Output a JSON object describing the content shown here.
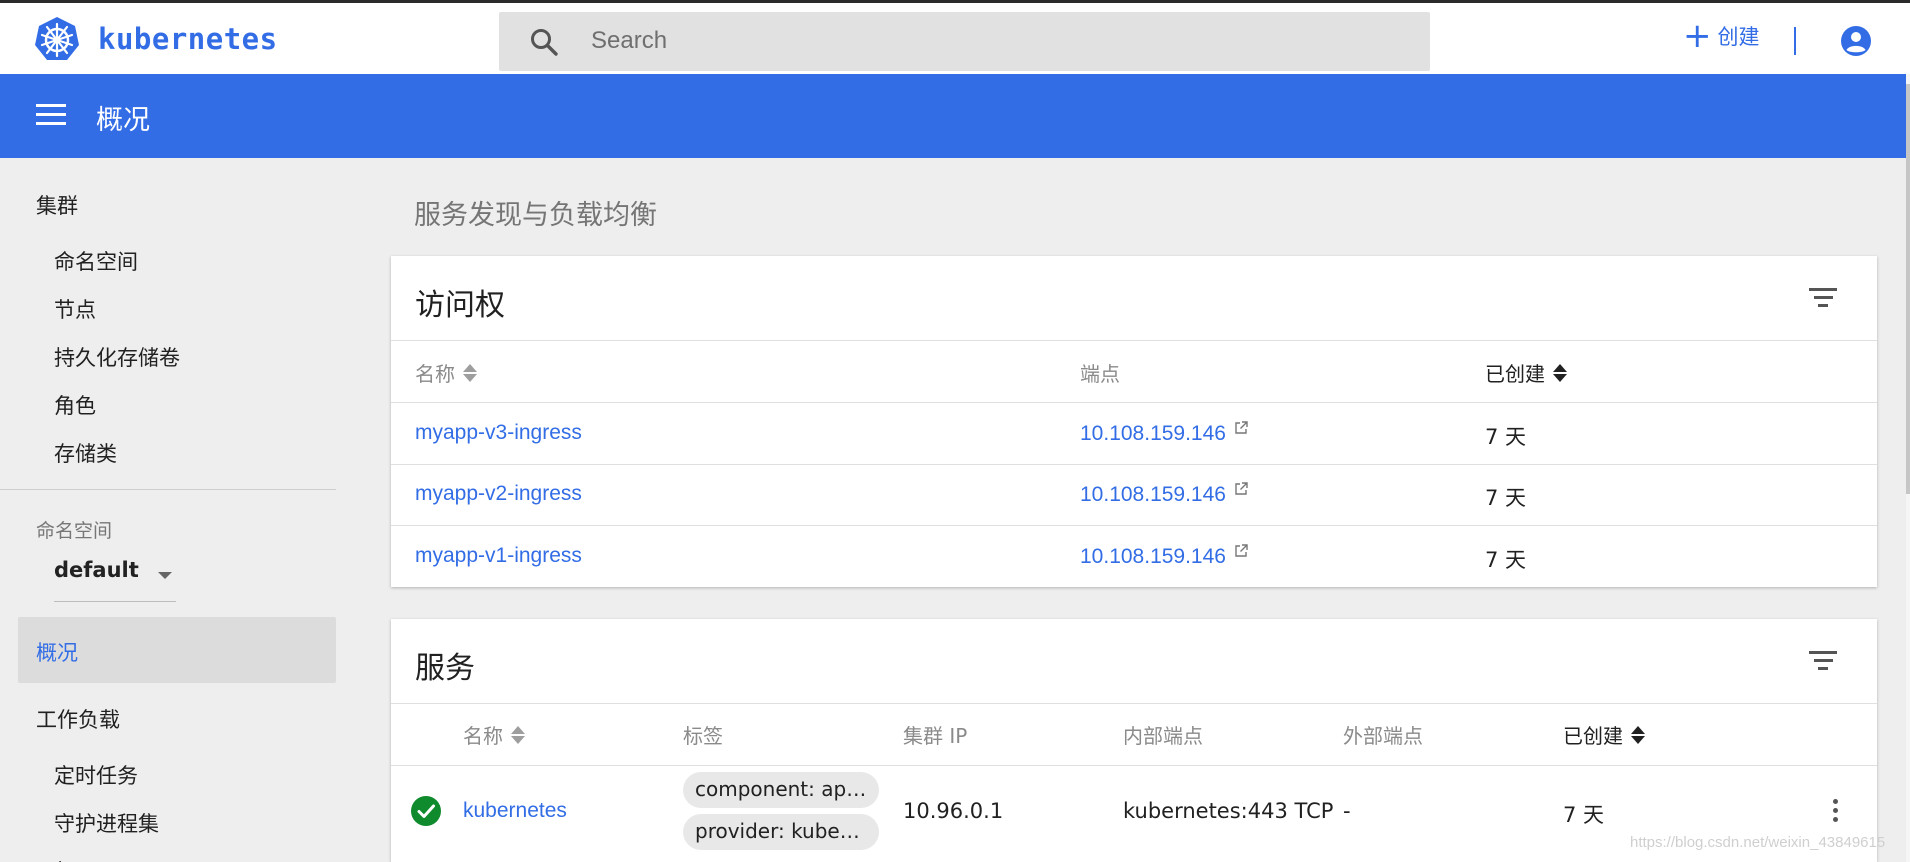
{
  "topbar": {
    "brand": "kubernetes",
    "search_placeholder": "Search",
    "create_label": "创建",
    "icons": {
      "logo": "kubernetes-wheel-icon",
      "search": "search-icon",
      "create": "plus-icon",
      "account": "account-circle-icon"
    }
  },
  "header": {
    "title": "概况",
    "menu_icon": "hamburger-menu-icon"
  },
  "sidebar": {
    "cluster_label": "集群",
    "cluster_items": [
      "命名空间",
      "节点",
      "持久化存储卷",
      "角色",
      "存储类"
    ],
    "namespace_label": "命名空间",
    "namespace_value": "default",
    "active_item": "概况",
    "workload_label": "工作负载",
    "workload_items": [
      "定时任务",
      "守护进程集",
      "部署"
    ]
  },
  "main": {
    "section_title": "服务发现与负载均衡",
    "ingress": {
      "title": "访问权",
      "columns": [
        "名称",
        "端点",
        "已创建"
      ],
      "rows": [
        {
          "name": "myapp-v3-ingress",
          "endpoint": "10.108.159.146",
          "created": "7 天"
        },
        {
          "name": "myapp-v2-ingress",
          "endpoint": "10.108.159.146",
          "created": "7 天"
        },
        {
          "name": "myapp-v1-ingress",
          "endpoint": "10.108.159.146",
          "created": "7 天"
        }
      ]
    },
    "services": {
      "title": "服务",
      "columns": [
        "名称",
        "标签",
        "集群 IP",
        "内部端点",
        "外部端点",
        "已创建"
      ],
      "rows": [
        {
          "name": "kubernetes",
          "labels": [
            "component: apiserver",
            "provider: kubernetes"
          ],
          "cluster_ip": "10.96.0.1",
          "internal_endpoint": "kubernetes:443 TCP",
          "external_endpoint": "-",
          "created": "7 天",
          "status": "ok"
        }
      ]
    }
  },
  "watermark": "https://blog.csdn.net/weixin_43849615",
  "colors": {
    "primary": "#326de6",
    "background": "#eeeeee",
    "status_ok": "#0f8a2c"
  }
}
